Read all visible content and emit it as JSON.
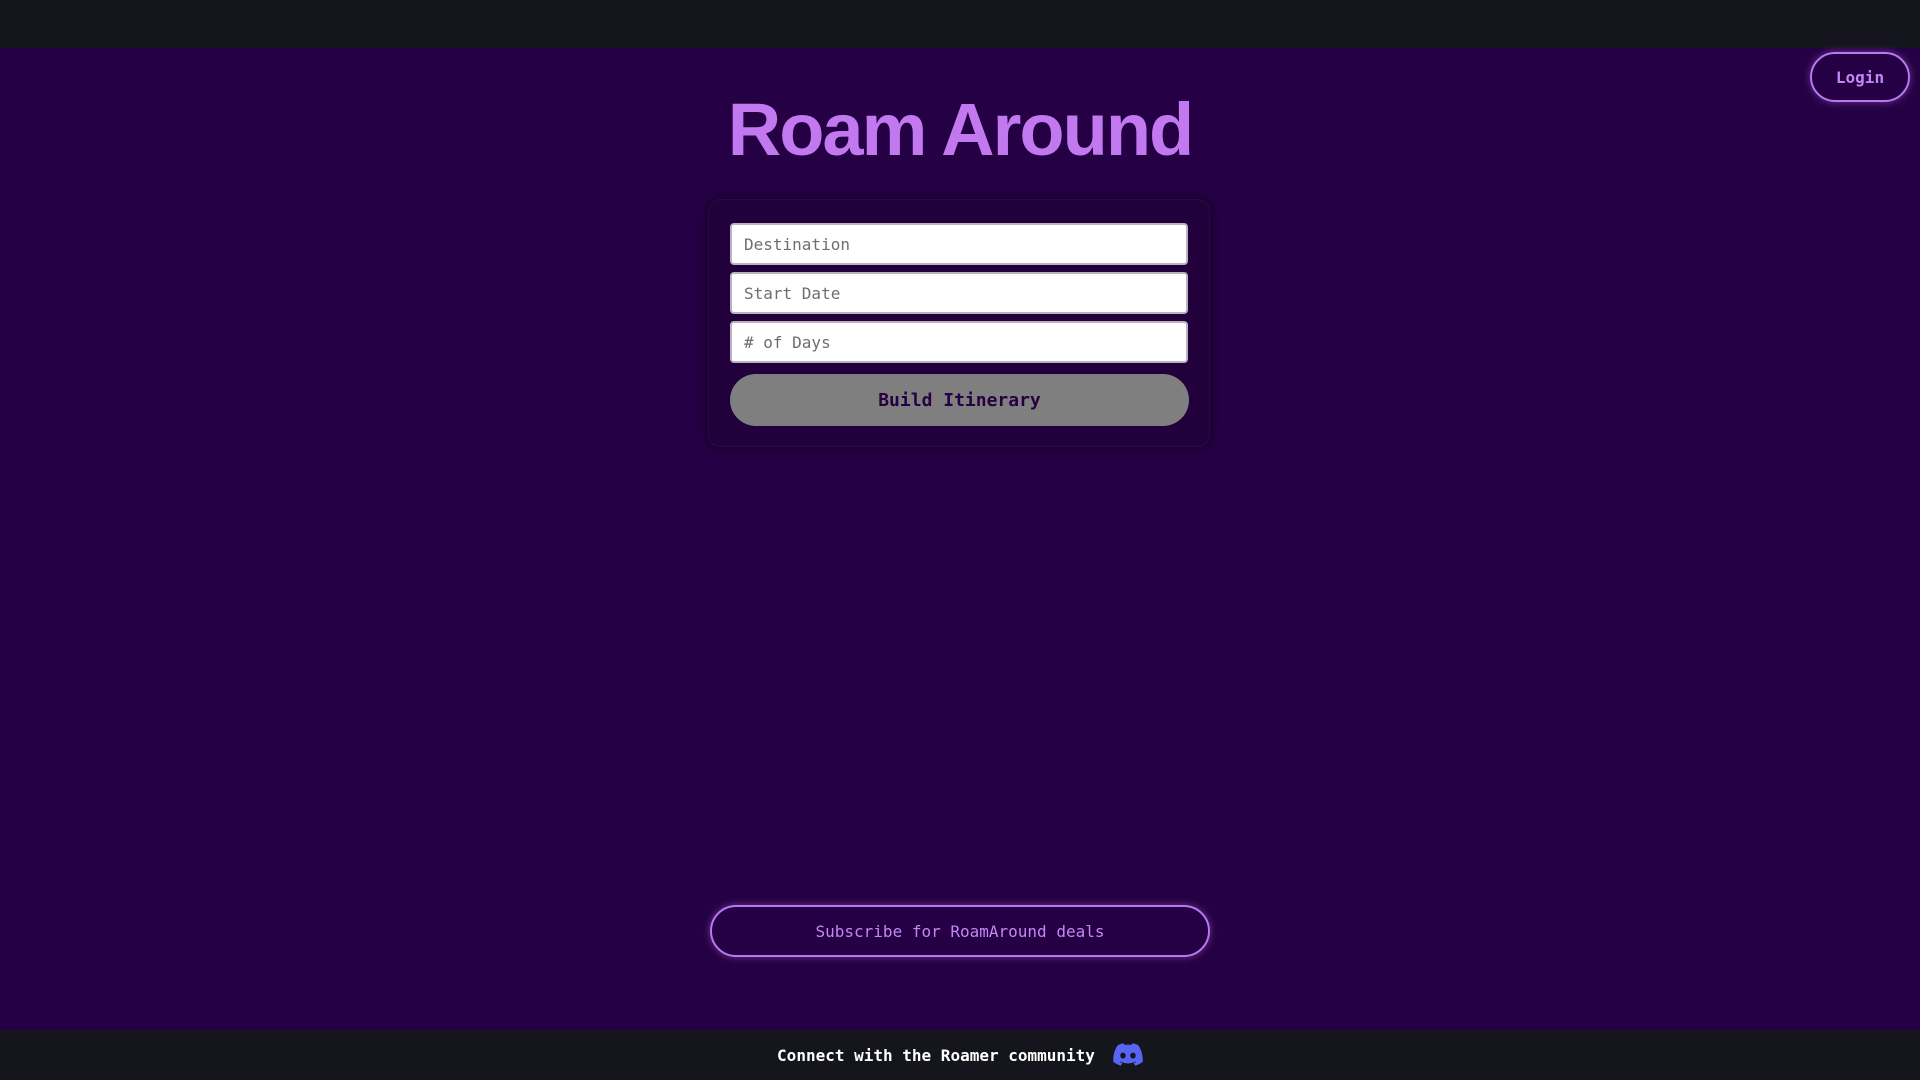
{
  "header": {
    "login_label": "Login"
  },
  "main": {
    "title": "Roam Around",
    "form": {
      "destination_placeholder": "Destination",
      "start_date_placeholder": "Start Date",
      "days_placeholder": "# of Days",
      "submit_label": "Build Itinerary"
    },
    "subscribe_label": "Subscribe for RoamAround deals"
  },
  "footer": {
    "text": "Connect with the Roamer community",
    "icon": "discord-icon"
  },
  "colors": {
    "background": "#250044",
    "accent": "#c279f0",
    "bar": "#15151d",
    "discord": "#5865f2"
  }
}
